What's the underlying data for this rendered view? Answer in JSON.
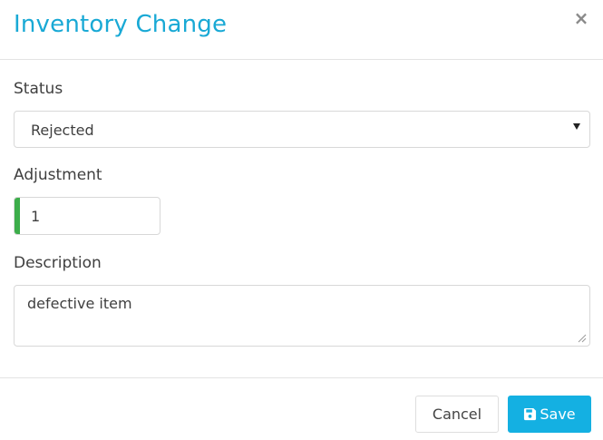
{
  "modal": {
    "title": "Inventory Change",
    "close_icon": "close-icon",
    "close_glyph": "×"
  },
  "form": {
    "status": {
      "label": "Status",
      "selected": "Rejected"
    },
    "adjustment": {
      "label": "Adjustment",
      "value": "1"
    },
    "description": {
      "label": "Description",
      "value": "defective item"
    }
  },
  "footer": {
    "cancel_label": "Cancel",
    "save_label": "Save",
    "save_icon": "floppy-disk-icon"
  },
  "colors": {
    "title": "#19a9d5",
    "primary": "#14b0e2",
    "valid": "#3cad4a"
  }
}
